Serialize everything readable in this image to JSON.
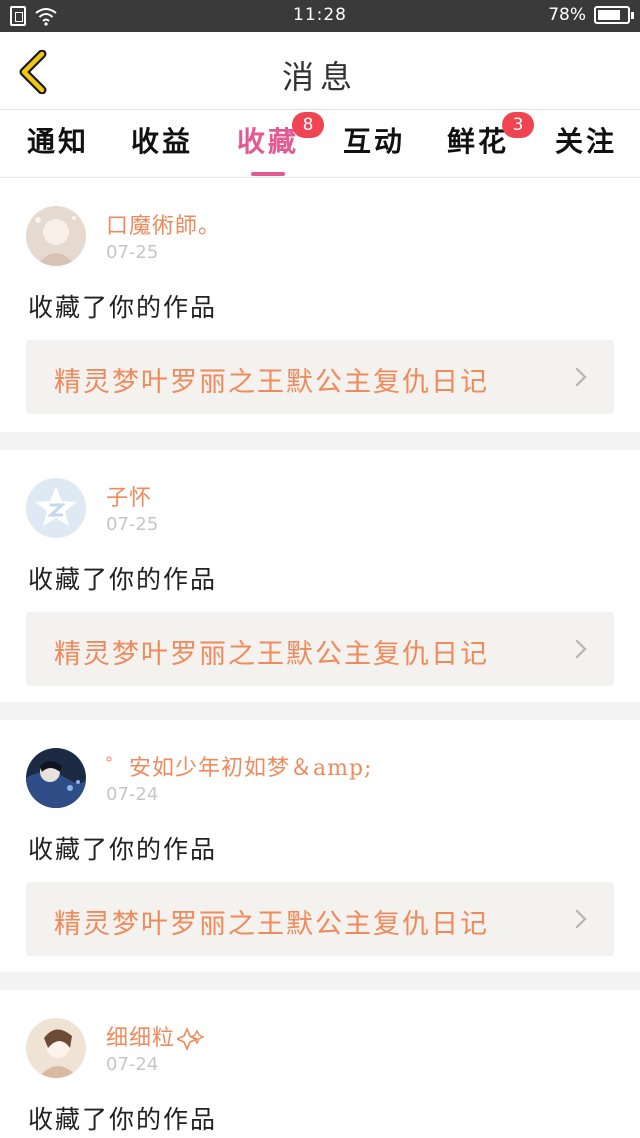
{
  "status_bar": {
    "time": "11:28",
    "battery_percent": "78%",
    "battery_level": 0.78,
    "icons": [
      "sim-icon",
      "wifi-icon",
      "battery-icon"
    ]
  },
  "header": {
    "title": "消息",
    "back_icon": "chevron-left-icon",
    "accent_color": "#f2c811"
  },
  "tabs": [
    {
      "label": "通知",
      "badge": null,
      "active": false
    },
    {
      "label": "收益",
      "badge": null,
      "active": false
    },
    {
      "label": "收藏",
      "badge": "8",
      "active": true
    },
    {
      "label": "互动",
      "badge": null,
      "active": false
    },
    {
      "label": "鲜花",
      "badge": "3",
      "active": false
    },
    {
      "label": "关注",
      "badge": null,
      "active": false
    }
  ],
  "colors": {
    "active_tab": "#e35a93",
    "badge": "#f04452",
    "username": "#ef8a5c",
    "work_title": "#ef8a5c"
  },
  "feed": [
    {
      "user_name": "口魔術師。",
      "time": "07-25",
      "action": "收藏了你的作品",
      "work_title": "精灵梦叶罗丽之王默公主复仇日记"
    },
    {
      "user_name": "子怀",
      "time": "07-25",
      "action": "收藏了你的作品",
      "work_title": "精灵梦叶罗丽之王默公主复仇日记"
    },
    {
      "user_name": "゜安如少年初如梦＆amp;",
      "time": "07-24",
      "action": "收藏了你的作品",
      "work_title": "精灵梦叶罗丽之王默公主复仇日记"
    },
    {
      "user_name": "细细粒",
      "time": "07-24",
      "action": "收藏了你的作品",
      "work_title": ""
    }
  ]
}
